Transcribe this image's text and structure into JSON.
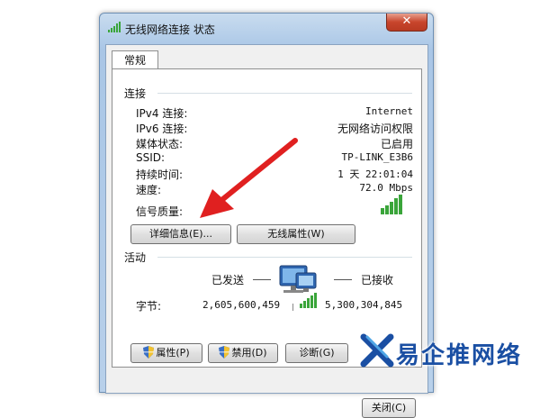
{
  "window": {
    "title": "无线网络连接 状态",
    "close_glyph": "✕"
  },
  "tabs": [
    {
      "label": "常规"
    }
  ],
  "connection": {
    "group_label": "连接",
    "rows": [
      {
        "key": "IPv4 连接:",
        "value": "Internet"
      },
      {
        "key": "IPv6 连接:",
        "value": "无网络访问权限"
      },
      {
        "key": "媒体状态:",
        "value": "已启用"
      },
      {
        "key": "SSID:",
        "value": "TP-LINK_E3B6"
      },
      {
        "key": "持续时间:",
        "value": "1 天 22:01:04"
      },
      {
        "key": "速度:",
        "value": "72.0 Mbps"
      }
    ],
    "signal_label": "信号质量:",
    "signal_bars": 5,
    "details_button": "详细信息(E)...",
    "wireless_props_button": "无线属性(W)"
  },
  "activity": {
    "group_label": "活动",
    "sent_label": "已发送",
    "received_label": "已接收",
    "bytes_label": "字节:",
    "bytes_sent": "2,605,600,459",
    "bytes_received": "5,300,304,845"
  },
  "buttons": {
    "properties": "属性(P)",
    "disable": "禁用(D)",
    "diagnose": "诊断(G)",
    "close": "关闭(C)"
  },
  "watermark": {
    "text": "易企推网络"
  },
  "colors": {
    "signal_green": "#3aa53a",
    "arrow_red": "#e02020",
    "title_bg": "#b8d0ea"
  }
}
